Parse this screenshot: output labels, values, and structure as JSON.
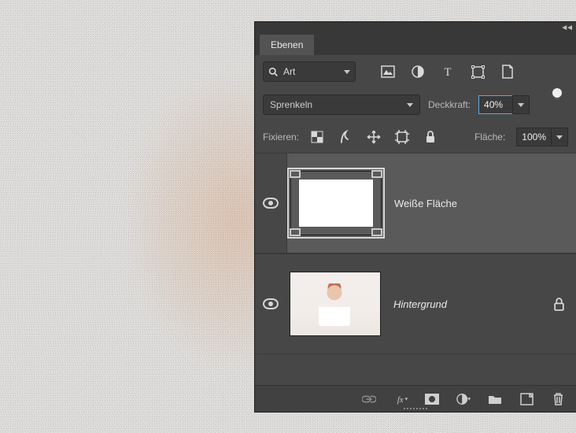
{
  "panel": {
    "title": "Ebenen",
    "filter": {
      "search_label": "Art"
    },
    "blend": {
      "mode": "Sprenkeln"
    },
    "opacity": {
      "label": "Deckkraft:",
      "value": "40%"
    },
    "lock": {
      "label": "Fixieren:"
    },
    "fill": {
      "label": "Fläche:",
      "value": "100%"
    },
    "layers": [
      {
        "name": "Weiße Fläche",
        "visible": true,
        "selected": true,
        "locked": false,
        "italic": false
      },
      {
        "name": "Hintergrund",
        "visible": true,
        "selected": false,
        "locked": true,
        "italic": true
      }
    ]
  }
}
